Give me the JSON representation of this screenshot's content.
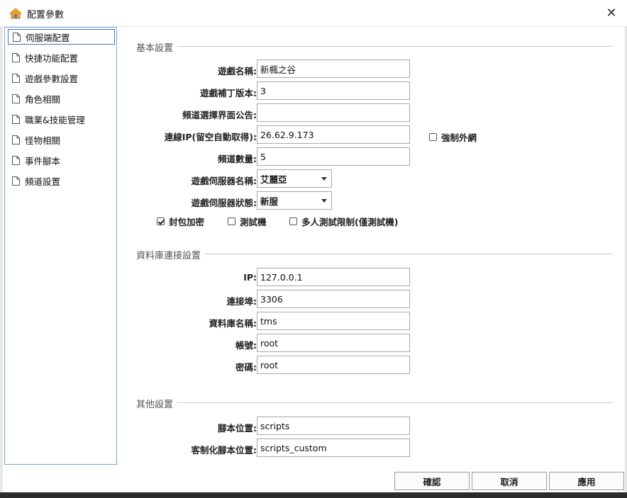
{
  "window": {
    "title": "配置參數",
    "close_glyph": "✕",
    "icon": "home-gear-icon",
    "accent_color": "#3b78c4"
  },
  "sidebar": {
    "items": [
      {
        "label": "伺服端配置",
        "selected": true
      },
      {
        "label": "快捷功能配置",
        "selected": false
      },
      {
        "label": "遊戲參數設置",
        "selected": false
      },
      {
        "label": "角色相關",
        "selected": false
      },
      {
        "label": "職業&技能管理",
        "selected": false
      },
      {
        "label": "怪物相關",
        "selected": false
      },
      {
        "label": "事件腳本",
        "selected": false
      },
      {
        "label": "頻道設置",
        "selected": false
      }
    ]
  },
  "basic": {
    "section_title": "基本設置",
    "game_name_label": "遊戲名稱:",
    "game_name_value": "新楓之谷",
    "patch_version_label": "遊戲補丁版本:",
    "patch_version_value": "3",
    "channel_notice_label": "頻道選擇界面公告:",
    "channel_notice_value": "",
    "connect_ip_label": "連線IP(留空自動取得):",
    "connect_ip_value": "26.62.9.173",
    "force_external_label": "強制外網",
    "force_external_checked": false,
    "channel_count_label": "頻道數量:",
    "channel_count_value": "5",
    "server_name_label": "遊戲伺服器名稱:",
    "server_name_value": "艾麗亞",
    "server_status_label": "遊戲伺服器狀態:",
    "server_status_value": "新服",
    "packet_encrypt_label": "封包加密",
    "packet_encrypt_checked": true,
    "test_server_label": "測試機",
    "test_server_checked": false,
    "multi_test_label": "多人測試限制(僅測試機)",
    "multi_test_checked": false
  },
  "database": {
    "section_title": "資料庫連接設置",
    "ip_label": "IP:",
    "ip_value": "127.0.0.1",
    "port_label": "連接埠:",
    "port_value": "3306",
    "db_name_label": "資料庫名稱:",
    "db_name_value": "tms",
    "account_label": "帳號:",
    "account_value": "root",
    "password_label": "密碼:",
    "password_value": "root"
  },
  "other": {
    "section_title": "其他設置",
    "script_path_label": "腳本位置:",
    "script_path_value": "scripts",
    "custom_script_path_label": "客制化腳本位置:",
    "custom_script_path_value": "scripts_custom"
  },
  "buttons": {
    "confirm": "確認",
    "cancel": "取消",
    "apply": "應用"
  }
}
